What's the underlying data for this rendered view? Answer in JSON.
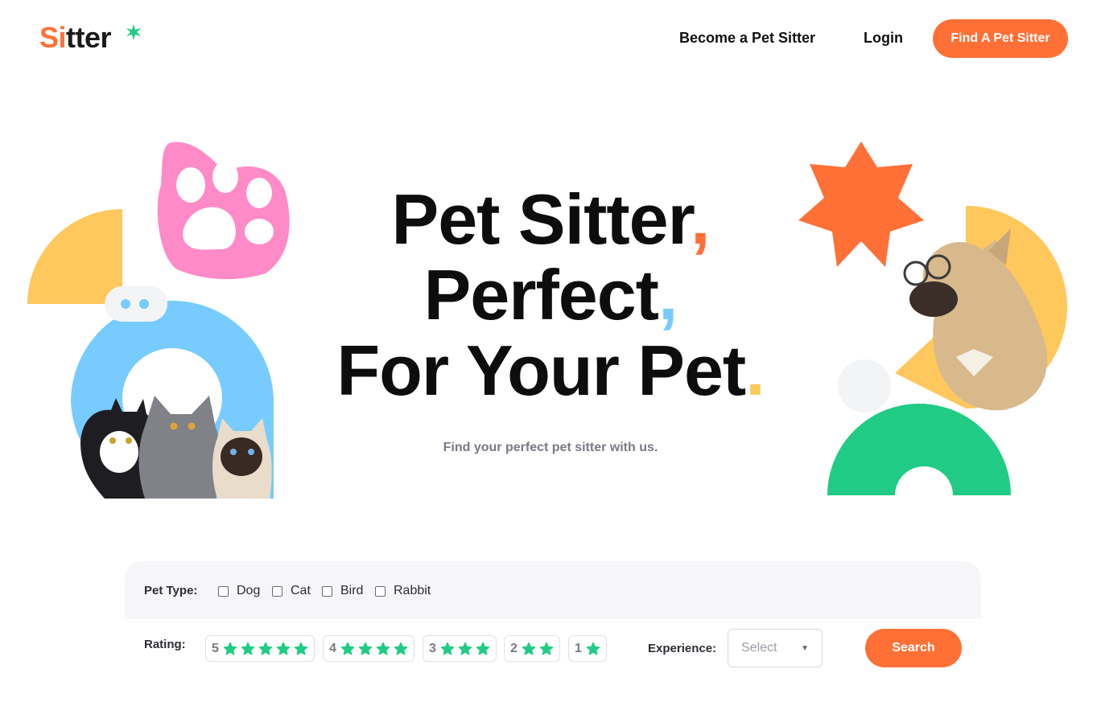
{
  "header": {
    "logo_accent": "Si",
    "logo_rest": "tter",
    "nav": {
      "become_label": "Become a Pet Sitter",
      "login_label": "Login",
      "find_label": "Find A Pet Sitter"
    }
  },
  "hero": {
    "line1": "Pet Sitter",
    "line2": "Perfect",
    "line3": "For Your Pet",
    "punct1": ",",
    "punct2": ",",
    "punct3": ".",
    "subtitle": "Find your perfect pet sitter with us."
  },
  "filters": {
    "pet_type_label": "Pet Type:",
    "pet_types": [
      "Dog",
      "Cat",
      "Bird",
      "Rabbit"
    ],
    "rating_label": "Rating:",
    "ratings": [
      "5",
      "4",
      "3",
      "2",
      "1"
    ],
    "experience_label": "Experience:",
    "experience_selected": "Select",
    "search_label": "Search"
  },
  "colors": {
    "orange": "#ff7037",
    "blue": "#77cbff",
    "yellow": "#ffc85d",
    "pink": "#ff8ac8",
    "green": "#20cc85",
    "gray_panel": "#f6f6f8"
  },
  "icons": [
    "sparkle-icon",
    "paw-icon",
    "star-icon",
    "chevron-down-icon"
  ]
}
